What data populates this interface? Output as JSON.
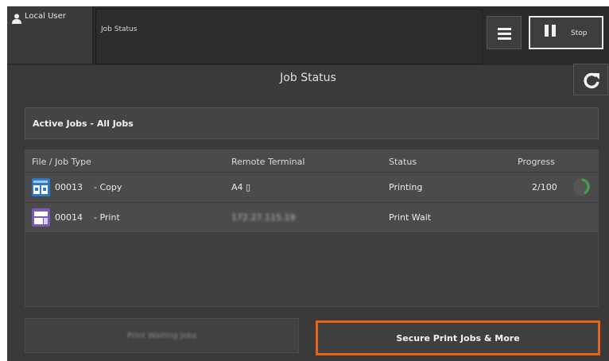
{
  "header": {
    "user_label": "Local User",
    "title_box_label": "Job Status",
    "stop_label": "Stop"
  },
  "page": {
    "title": "Job Status"
  },
  "filter": {
    "label": "Active Jobs - All Jobs"
  },
  "table": {
    "columns": [
      "File / Job Type",
      "Remote Terminal",
      "Status",
      "Progress"
    ],
    "rows": [
      {
        "job": "00013",
        "type": "- Copy",
        "terminal": "A4 ▯",
        "status": "Printing",
        "progress": "2/100",
        "icon": "copy-job-icon"
      },
      {
        "job": "00014",
        "type": "- Print",
        "terminal": "172.27.115.19",
        "status": "Print Wait",
        "progress": "",
        "icon": "print-job-icon"
      }
    ]
  },
  "buttons": {
    "left_label": "Print Waiting Jobs",
    "right_label": "Secure Print Jobs & More"
  },
  "colors": {
    "accent": "#e8621a",
    "copy_icon": "#2f78c4",
    "print_icon": "#7b5bb5",
    "spinner": "#3fa64a"
  }
}
